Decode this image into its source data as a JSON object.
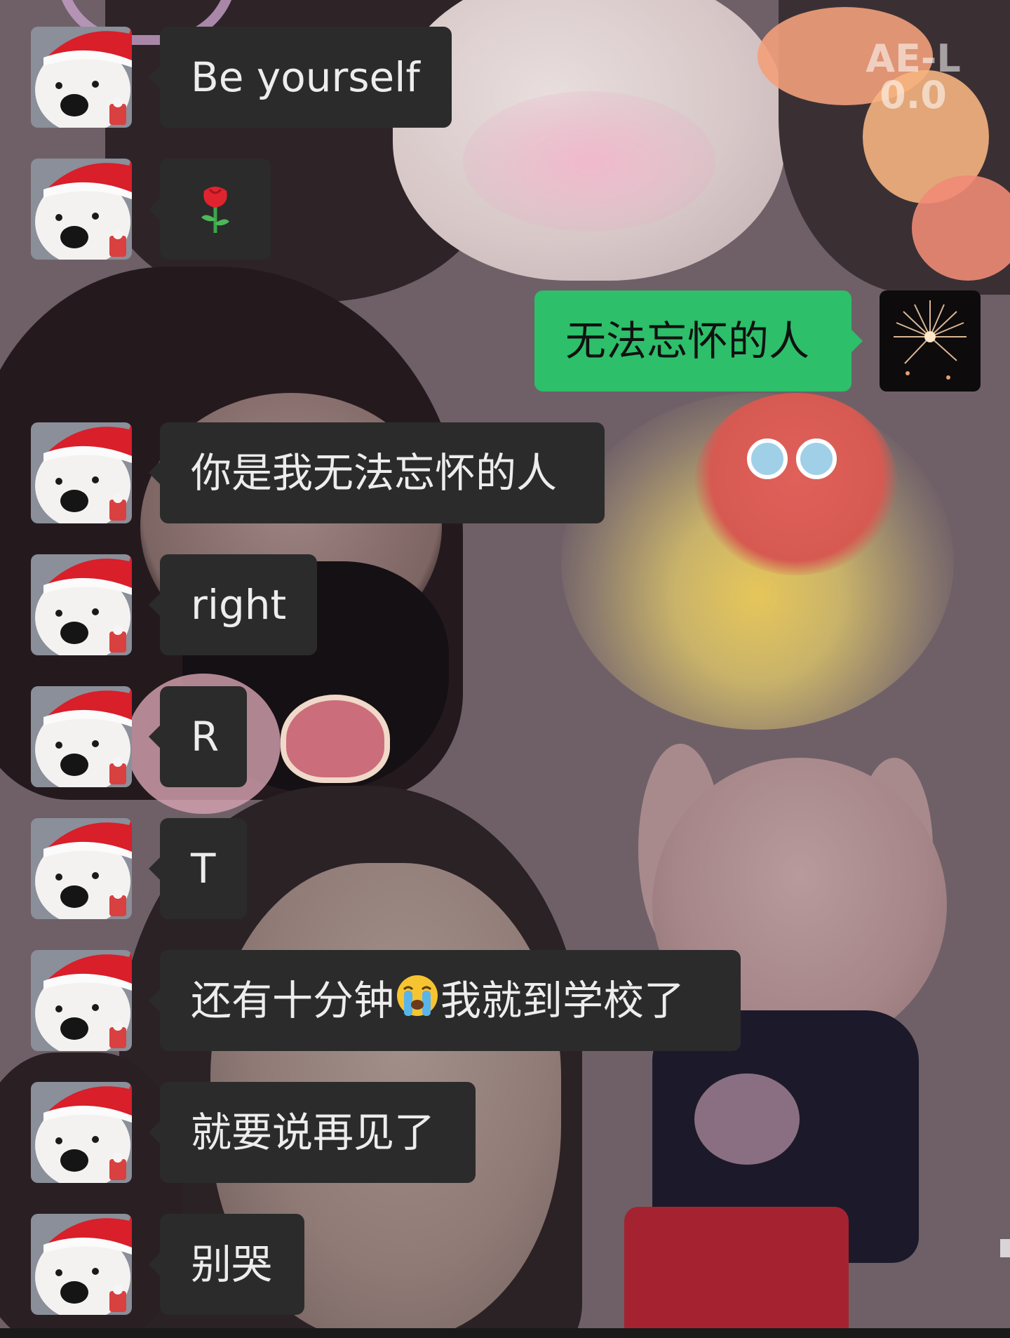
{
  "watermark": {
    "line1": "AE-L",
    "line2": "0.0"
  },
  "contacts": {
    "incoming_avatar_icon": "white-puppy-santa-hat-icon",
    "outgoing_avatar_icon": "fireworks-icon"
  },
  "messages": [
    {
      "direction": "incoming",
      "text": "Be yourself"
    },
    {
      "direction": "incoming",
      "text": "🌹",
      "icon": "rose-icon"
    },
    {
      "direction": "outgoing",
      "text": "无法忘怀的人"
    },
    {
      "direction": "incoming",
      "text": "你是我无法忘怀的人"
    },
    {
      "direction": "incoming",
      "text": "right"
    },
    {
      "direction": "incoming",
      "text": "R"
    },
    {
      "direction": "incoming",
      "text": "T"
    },
    {
      "direction": "incoming",
      "text_before": "还有十分钟",
      "emoji": "😭",
      "emoji_icon": "loudly-crying-face-icon",
      "text_after": "我就到学校了"
    },
    {
      "direction": "incoming",
      "text": "就要说再见了"
    },
    {
      "direction": "incoming",
      "text": "别哭"
    }
  ],
  "colors": {
    "incoming_bubble": "#2b2b2b",
    "outgoing_bubble": "#2dbf6a",
    "incoming_text": "#ededed",
    "outgoing_text": "#111111"
  }
}
